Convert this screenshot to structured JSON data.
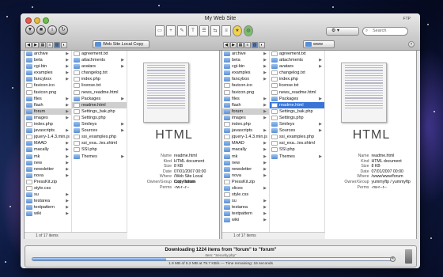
{
  "window": {
    "title": "My Web Site",
    "ftp_label": "FTP"
  },
  "toolbar": {
    "search_placeholder": "Search",
    "action_label": "⚙"
  },
  "left": {
    "path": "Web Site Local Copy",
    "col1": [
      {
        "name": "archive",
        "type": "folder",
        "arrow": true
      },
      {
        "name": "beta",
        "type": "folder",
        "arrow": true
      },
      {
        "name": "cgi-bin",
        "type": "folder",
        "arrow": true
      },
      {
        "name": "examples",
        "type": "folder",
        "arrow": true
      },
      {
        "name": "fancybox",
        "type": "folder",
        "arrow": true
      },
      {
        "name": "favicon.ico",
        "type": "file",
        "arrow": false
      },
      {
        "name": "favicon.png",
        "type": "file",
        "arrow": false
      },
      {
        "name": "files",
        "type": "folder",
        "arrow": true
      },
      {
        "name": "flash",
        "type": "folder",
        "arrow": true
      },
      {
        "name": "forum",
        "type": "folder",
        "arrow": true,
        "selected": "gray"
      },
      {
        "name": "images",
        "type": "folder",
        "arrow": true
      },
      {
        "name": "index.php",
        "type": "file",
        "arrow": false
      },
      {
        "name": "javascripts",
        "type": "folder",
        "arrow": true
      },
      {
        "name": "jquery-1.4.3.min.js",
        "type": "file",
        "arrow": false
      },
      {
        "name": "MAAD",
        "type": "folder",
        "arrow": true
      },
      {
        "name": "macally",
        "type": "folder",
        "arrow": true
      },
      {
        "name": "mk",
        "type": "folder",
        "arrow": true
      },
      {
        "name": "new",
        "type": "folder",
        "arrow": true
      },
      {
        "name": "newsletter",
        "type": "folder",
        "arrow": true
      },
      {
        "name": "nova",
        "type": "folder",
        "arrow": true
      },
      {
        "name": "PressKit.zip",
        "type": "file",
        "arrow": false
      },
      {
        "name": "style.css",
        "type": "file",
        "arrow": false
      },
      {
        "name": "su",
        "type": "folder",
        "arrow": true
      },
      {
        "name": "testarea",
        "type": "folder",
        "arrow": true
      },
      {
        "name": "textpattern",
        "type": "folder",
        "arrow": true
      },
      {
        "name": "wiki",
        "type": "folder",
        "arrow": true
      }
    ],
    "col2": [
      {
        "name": "agreement.txt",
        "type": "file",
        "arrow": false
      },
      {
        "name": "attachments",
        "type": "folder",
        "arrow": true
      },
      {
        "name": "avatars",
        "type": "folder",
        "arrow": true
      },
      {
        "name": "changelog.txt",
        "type": "file",
        "arrow": false
      },
      {
        "name": "index.php",
        "type": "file",
        "arrow": false
      },
      {
        "name": "license.txt",
        "type": "file",
        "arrow": false
      },
      {
        "name": "news_readme.html",
        "type": "file",
        "arrow": false
      },
      {
        "name": "Packages",
        "type": "folder",
        "arrow": true
      },
      {
        "name": "readme.html",
        "type": "file",
        "arrow": false,
        "selected": "gray"
      },
      {
        "name": "Settings_bak.php",
        "type": "file",
        "arrow": false
      },
      {
        "name": "Settings.php",
        "type": "file",
        "arrow": false
      },
      {
        "name": "Smileys",
        "type": "folder",
        "arrow": true
      },
      {
        "name": "Sources",
        "type": "folder",
        "arrow": true
      },
      {
        "name": "ssi_examples.php",
        "type": "file",
        "arrow": false
      },
      {
        "name": "ssi_exa...les.shtml",
        "type": "file",
        "arrow": false
      },
      {
        "name": "SSI.php",
        "type": "file",
        "arrow": false
      },
      {
        "name": "Themes",
        "type": "folder",
        "arrow": true
      }
    ],
    "count": "1 of 17 items",
    "preview": {
      "kind_label": "HTML",
      "info": [
        {
          "k": "Name",
          "v": "readme.html"
        },
        {
          "k": "Kind",
          "v": "HTML document"
        },
        {
          "k": "Size",
          "v": "8 KB"
        },
        {
          "k": "Date",
          "v": "07/01/2007 00:00"
        },
        {
          "k": "Where",
          "v": "/Web Site Local Copy/forum"
        },
        {
          "k": "Owner/Group",
          "v": "root / admin"
        },
        {
          "k": "Perms",
          "v": "-rw-r--r--"
        }
      ]
    }
  },
  "right": {
    "path": "www",
    "col1": [
      {
        "name": "archive",
        "type": "folder",
        "arrow": true
      },
      {
        "name": "beta",
        "type": "folder",
        "arrow": true
      },
      {
        "name": "cgi-bin",
        "type": "folder",
        "arrow": true
      },
      {
        "name": "examples",
        "type": "folder",
        "arrow": true
      },
      {
        "name": "fancybox",
        "type": "folder",
        "arrow": true
      },
      {
        "name": "favicon.ico",
        "type": "file",
        "arrow": false
      },
      {
        "name": "favicon.png",
        "type": "file",
        "arrow": false
      },
      {
        "name": "files",
        "type": "folder",
        "arrow": true
      },
      {
        "name": "flash",
        "type": "folder",
        "arrow": true
      },
      {
        "name": "forum",
        "type": "folder",
        "arrow": true,
        "selected": "gray"
      },
      {
        "name": "images",
        "type": "folder",
        "arrow": true
      },
      {
        "name": "index.php",
        "type": "file",
        "arrow": false
      },
      {
        "name": "javascripts",
        "type": "folder",
        "arrow": true
      },
      {
        "name": "jquery-1.4.3.min.js",
        "type": "file",
        "arrow": false
      },
      {
        "name": "MAAD",
        "type": "folder",
        "arrow": true
      },
      {
        "name": "macally",
        "type": "folder",
        "arrow": true
      },
      {
        "name": "mk",
        "type": "folder",
        "arrow": true
      },
      {
        "name": "new",
        "type": "folder",
        "arrow": true
      },
      {
        "name": "newsletter",
        "type": "folder",
        "arrow": true
      },
      {
        "name": "nova",
        "type": "folder",
        "arrow": true
      },
      {
        "name": "PressKit.zip",
        "type": "file",
        "arrow": false
      },
      {
        "name": "slices",
        "type": "folder",
        "arrow": true
      },
      {
        "name": "style.css",
        "type": "file",
        "arrow": false
      },
      {
        "name": "su",
        "type": "folder",
        "arrow": true
      },
      {
        "name": "testarea",
        "type": "folder",
        "arrow": true
      },
      {
        "name": "textpattern",
        "type": "folder",
        "arrow": true
      },
      {
        "name": "wiki",
        "type": "folder",
        "arrow": true
      }
    ],
    "col2": [
      {
        "name": "agreement.txt",
        "type": "file",
        "arrow": false
      },
      {
        "name": "attachments",
        "type": "folder",
        "arrow": true
      },
      {
        "name": "avatars",
        "type": "folder",
        "arrow": true
      },
      {
        "name": "changelog.txt",
        "type": "file",
        "arrow": false
      },
      {
        "name": "index.php",
        "type": "file",
        "arrow": false
      },
      {
        "name": "license.txt",
        "type": "file",
        "arrow": false
      },
      {
        "name": "news_readme.html",
        "type": "file",
        "arrow": false
      },
      {
        "name": "Packages",
        "type": "folder",
        "arrow": true
      },
      {
        "name": "readme.html",
        "type": "file",
        "arrow": false,
        "selected": "blue"
      },
      {
        "name": "Settings_bak.php",
        "type": "file",
        "arrow": false
      },
      {
        "name": "Settings.php",
        "type": "file",
        "arrow": false
      },
      {
        "name": "Smileys",
        "type": "folder",
        "arrow": true
      },
      {
        "name": "Sources",
        "type": "folder",
        "arrow": true
      },
      {
        "name": "ssi_examples.php",
        "type": "file",
        "arrow": false
      },
      {
        "name": "ssi_exa...les.shtml",
        "type": "file",
        "arrow": false
      },
      {
        "name": "SSI.php",
        "type": "file",
        "arrow": false
      },
      {
        "name": "Themes",
        "type": "folder",
        "arrow": true
      }
    ],
    "count": "1 of 17 items",
    "preview": {
      "kind_label": "HTML",
      "info": [
        {
          "k": "Name",
          "v": "readme.html"
        },
        {
          "k": "Kind",
          "v": "HTML document"
        },
        {
          "k": "Size",
          "v": "8 KB"
        },
        {
          "k": "Date",
          "v": "07/01/2007 00:00"
        },
        {
          "k": "Where",
          "v": "/www/www/forum"
        },
        {
          "k": "Owner/Group",
          "v": "yummyftp / yummyftp"
        },
        {
          "k": "Perms",
          "v": "-rw-r--r--"
        }
      ]
    }
  },
  "transfer": {
    "title": "Downloading 1224 items from \"forum\" to \"forum\"",
    "item": "Item: \"Security.php\"",
    "detail": "1.9 MB of 5.2 MB at 79.7 KB/s — Time remaining: 16 seconds",
    "progress": 0.37
  },
  "colors": {
    "selection": "#3875d7",
    "folder": "#5a8fd6"
  }
}
